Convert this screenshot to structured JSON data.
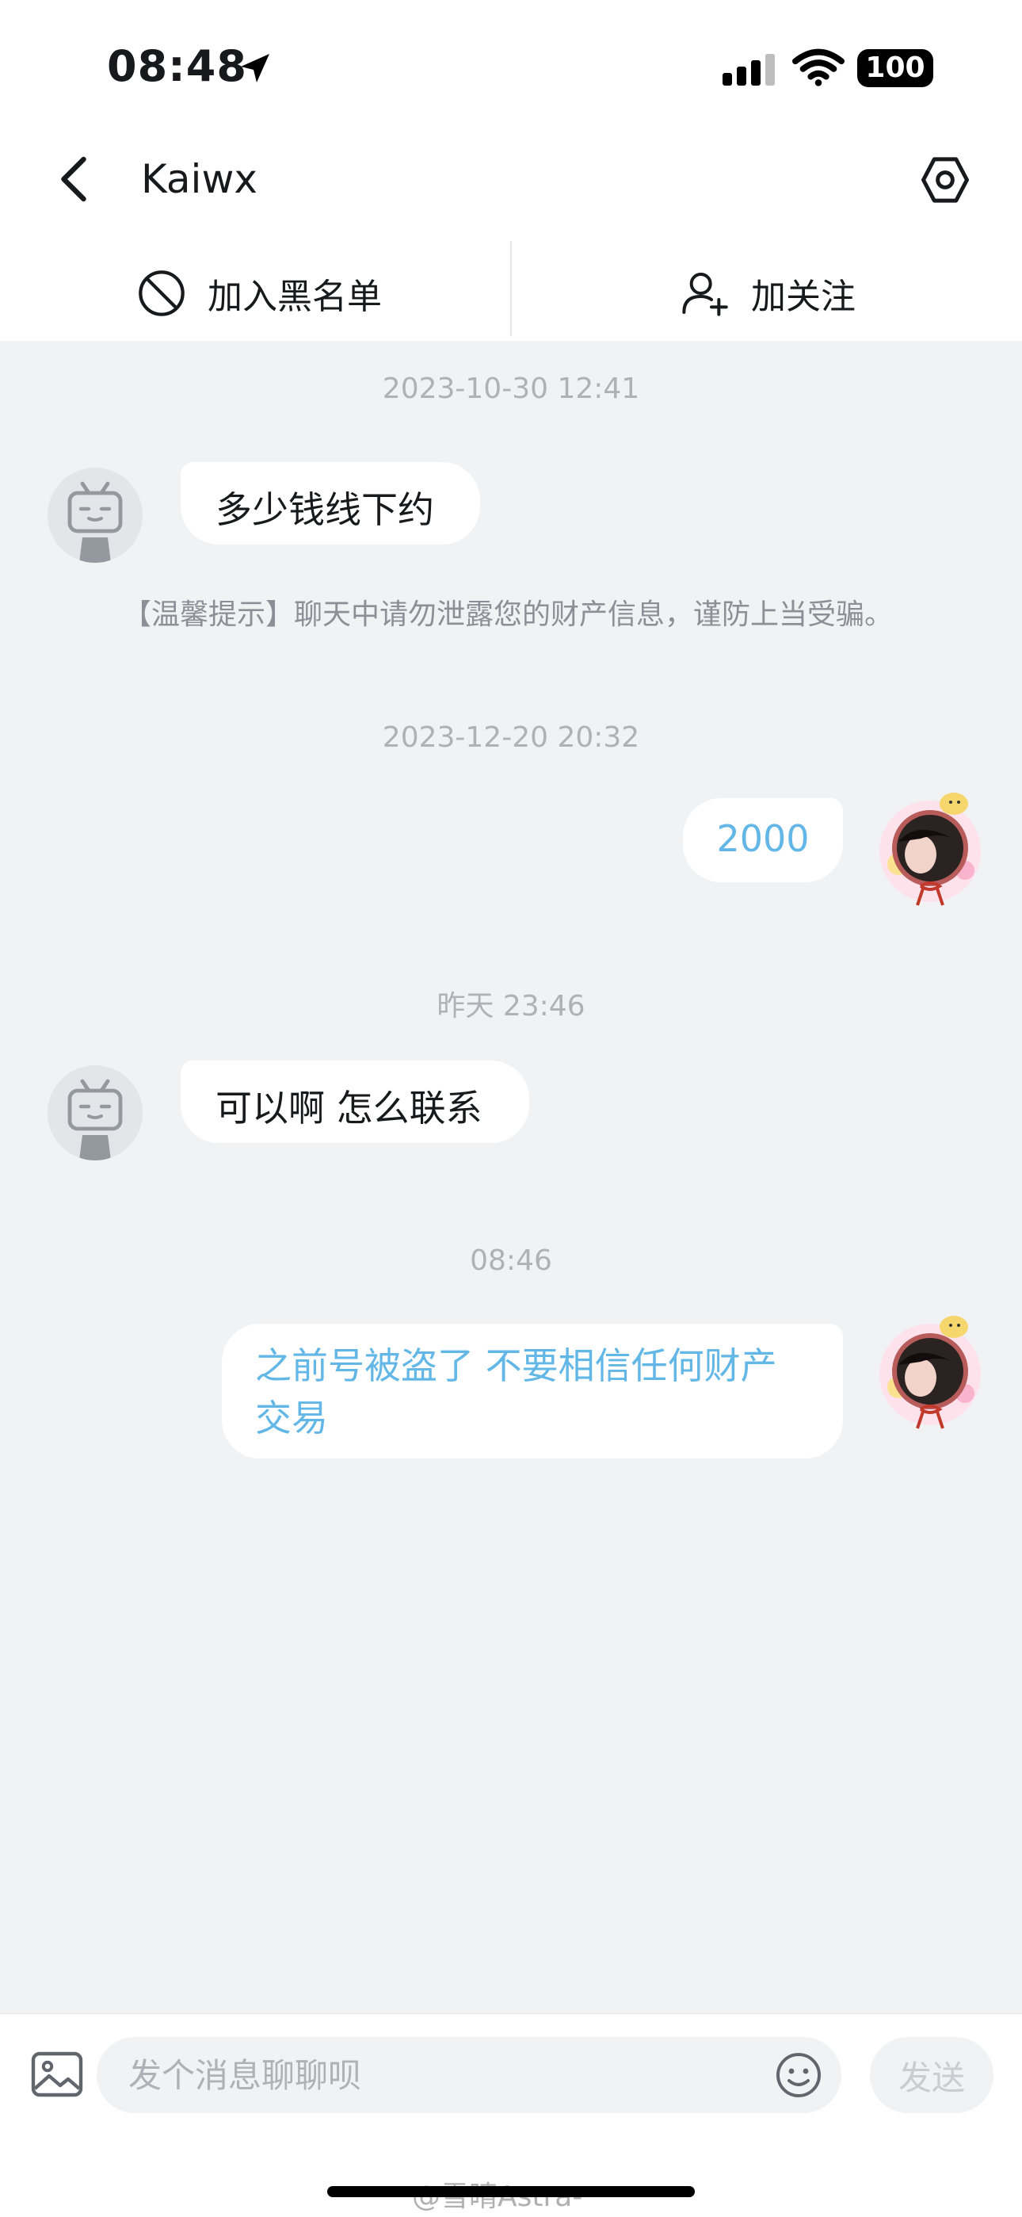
{
  "status_bar": {
    "time": "08:48",
    "battery": "100"
  },
  "header": {
    "title": "Kaiwx"
  },
  "actions": {
    "block_label": "加入黑名单",
    "follow_label": "加关注"
  },
  "chat": {
    "timestamps": [
      "2023-10-30 12:41",
      "2023-12-20 20:32",
      "昨天 23:46",
      "08:46"
    ],
    "messages": [
      {
        "from": "them",
        "text": "多少钱线下约"
      },
      {
        "from": "me",
        "text": "2000"
      },
      {
        "from": "them",
        "text": "可以啊 怎么联系"
      },
      {
        "from": "me",
        "text": "之前号被盗了 不要相信任何财产交易"
      }
    ],
    "tip": "【温馨提示】聊天中请勿泄露您的财产信息，谨防上当受骗。"
  },
  "input_bar": {
    "placeholder": "发个消息聊聊呗",
    "send_label": "发送"
  },
  "watermark": "@雪晴Astra-",
  "colors": {
    "outgoing_text": "#63b7e6",
    "chat_background": "#f1f2f4"
  }
}
